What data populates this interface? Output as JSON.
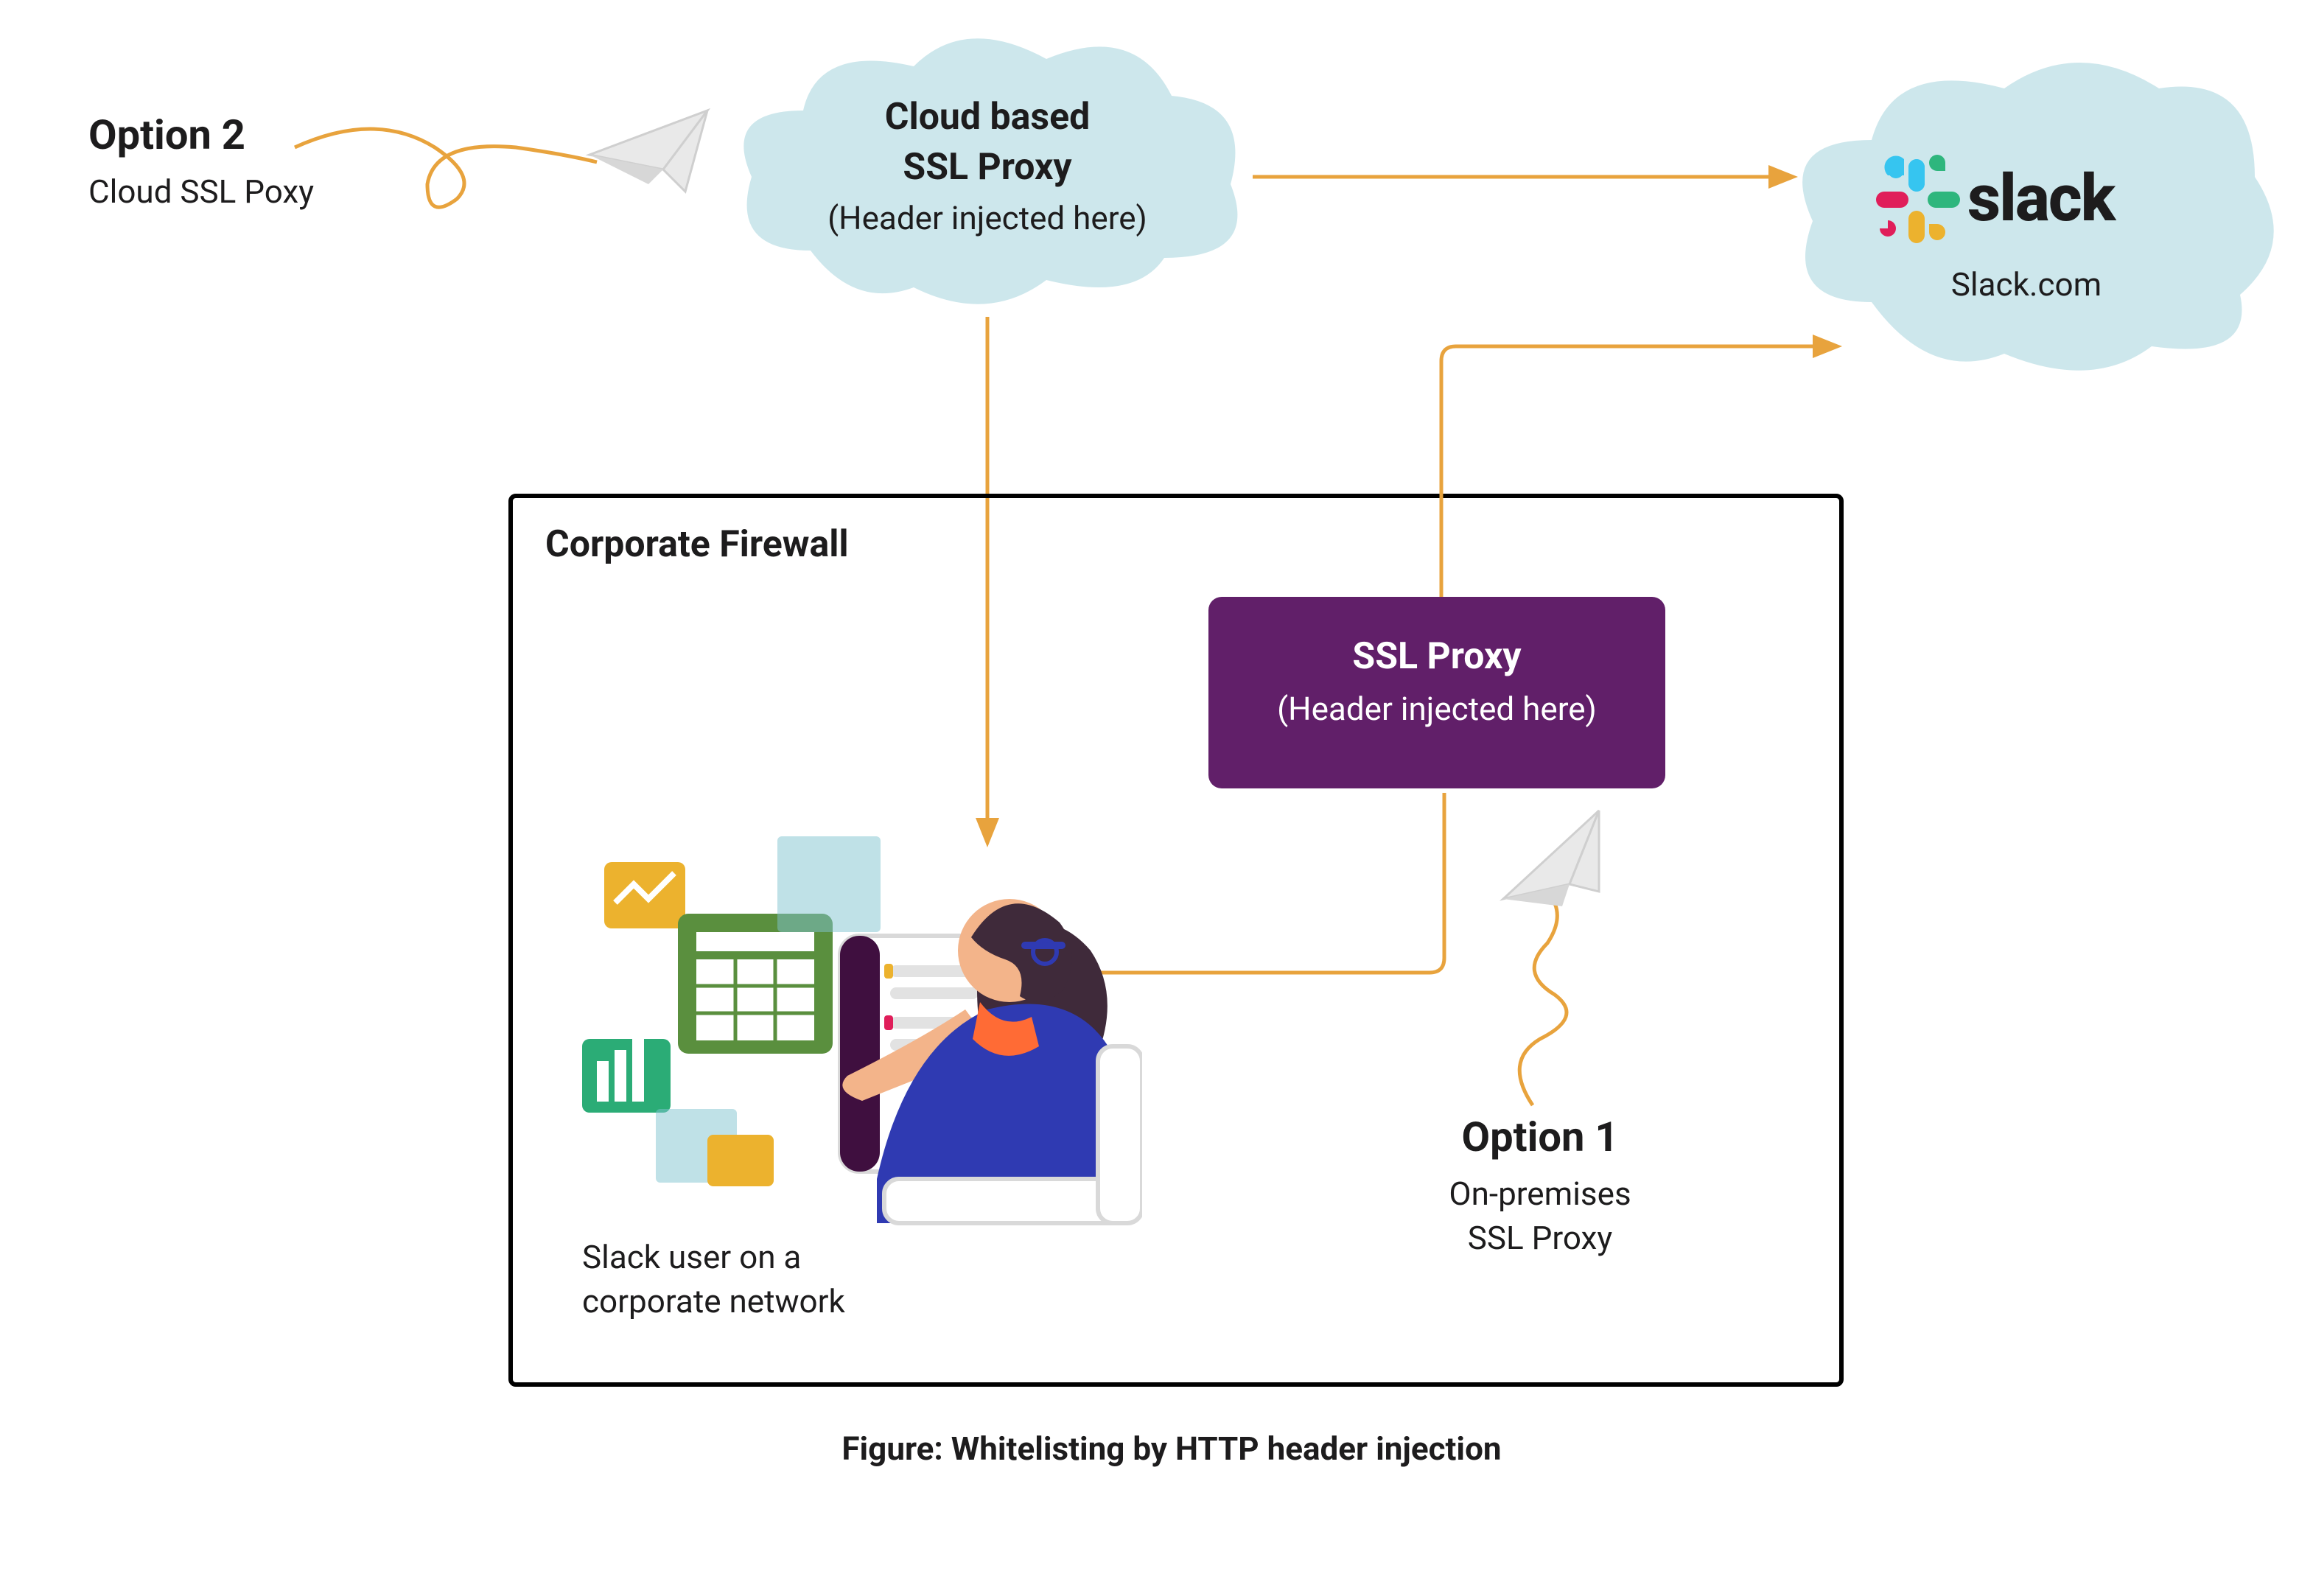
{
  "option2": {
    "title": "Option 2",
    "subtitle": "Cloud SSL Poxy"
  },
  "cloud_proxy": {
    "line1": "Cloud based",
    "line2": "SSL Proxy",
    "note": "(Header injected here)"
  },
  "slack_cloud": {
    "brand": "slack",
    "domain": "Slack.com"
  },
  "firewall": {
    "title": "Corporate Firewall"
  },
  "ssl_box": {
    "title": "SSL Proxy",
    "note": "(Header injected here)"
  },
  "option1": {
    "title": "Option 1",
    "line1": "On-premises",
    "line2": "SSL Proxy"
  },
  "user": {
    "line1": "Slack user on a",
    "line2": "corporate network"
  },
  "figure_caption": "Figure: Whitelisting by HTTP header injection",
  "colors": {
    "accent": "#e8a33d",
    "cloud": "#cde7ec",
    "purple": "#611f69",
    "slack_green": "#2eb67d",
    "slack_blue": "#36c5f0",
    "slack_red": "#e01e5a",
    "slack_yellow": "#ecb22e"
  }
}
